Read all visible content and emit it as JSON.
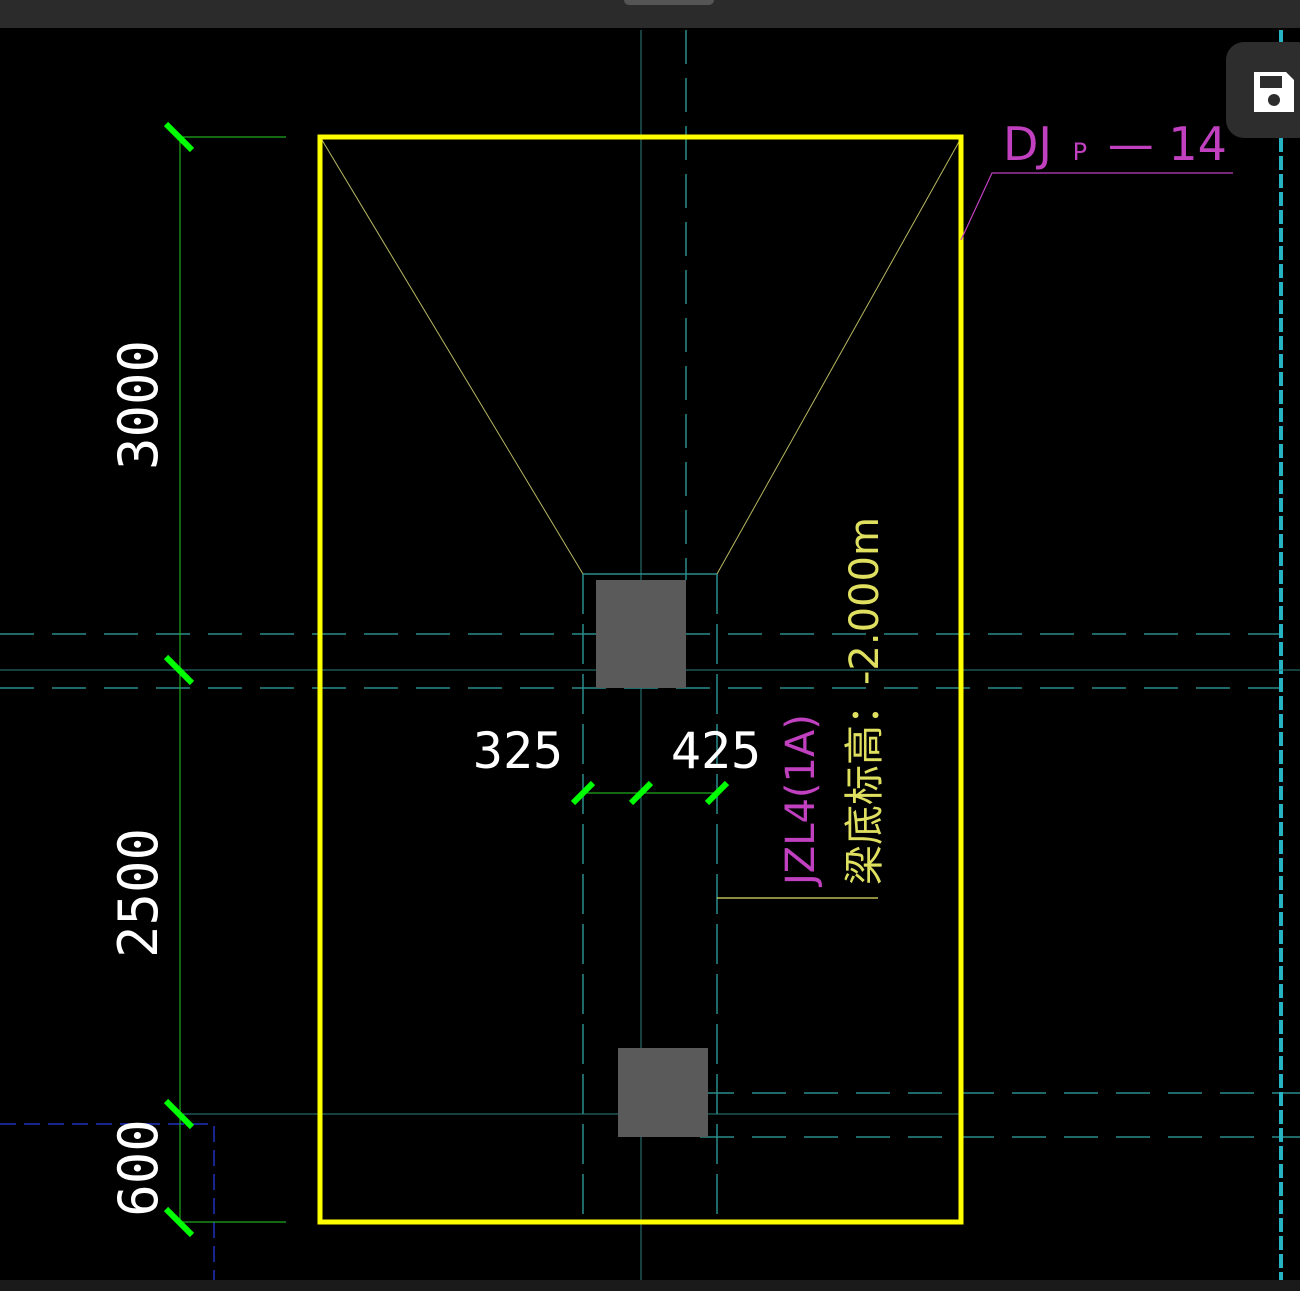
{
  "footing": {
    "label_main": "DJ",
    "label_sub": "P",
    "label_suffix": "— 14"
  },
  "dimensions": {
    "left_top": "3000",
    "left_middle": "2500",
    "left_bottom": "600",
    "col_left": "325",
    "col_right": "425"
  },
  "beam": {
    "label": "JZL4(1A)",
    "elevation": "梁底标高：-2.000m"
  },
  "toolbar": {
    "save_icon": "save-icon"
  },
  "colors": {
    "footing_outline": "#ffff00",
    "dimension_line": "#1faa1f",
    "dimension_tick": "#00ff00",
    "axis_line": "#2a8c8c",
    "column_fill": "#5a5a5a",
    "label_magenta": "#c040c0",
    "label_yellow": "#e0e060",
    "text_white": "#ffffff"
  }
}
